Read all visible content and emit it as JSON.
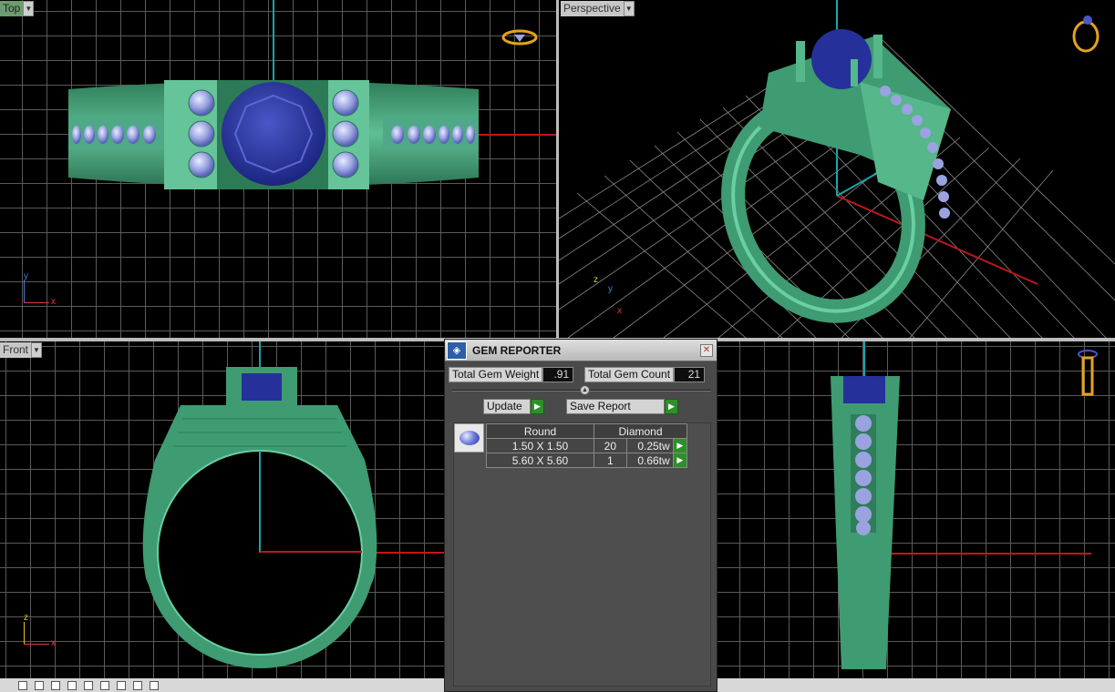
{
  "viewports": {
    "top": {
      "label": "Top"
    },
    "perspective": {
      "label": "Perspective"
    },
    "front": {
      "label": "Front"
    }
  },
  "axes": {
    "x": "x",
    "y": "y",
    "z": "z"
  },
  "gem_reporter": {
    "title": "GEM REPORTER",
    "total_weight_label": "Total Gem Weight",
    "total_weight_value": ".91",
    "total_count_label": "Total Gem Count",
    "total_count_value": "21",
    "update_label": "Update",
    "save_report_label": "Save Report",
    "table": {
      "shape": "Round",
      "type": "Diamond",
      "rows": [
        {
          "size": "1.50 X 1.50",
          "count": "20",
          "weight": "0.25tw"
        },
        {
          "size": "5.60 X 5.60",
          "count": "1",
          "weight": "0.66tw"
        }
      ]
    }
  },
  "colors": {
    "ring_green": "#3f9b72",
    "sapphire": "#26309a",
    "accent_green": "#2f8f2a"
  }
}
